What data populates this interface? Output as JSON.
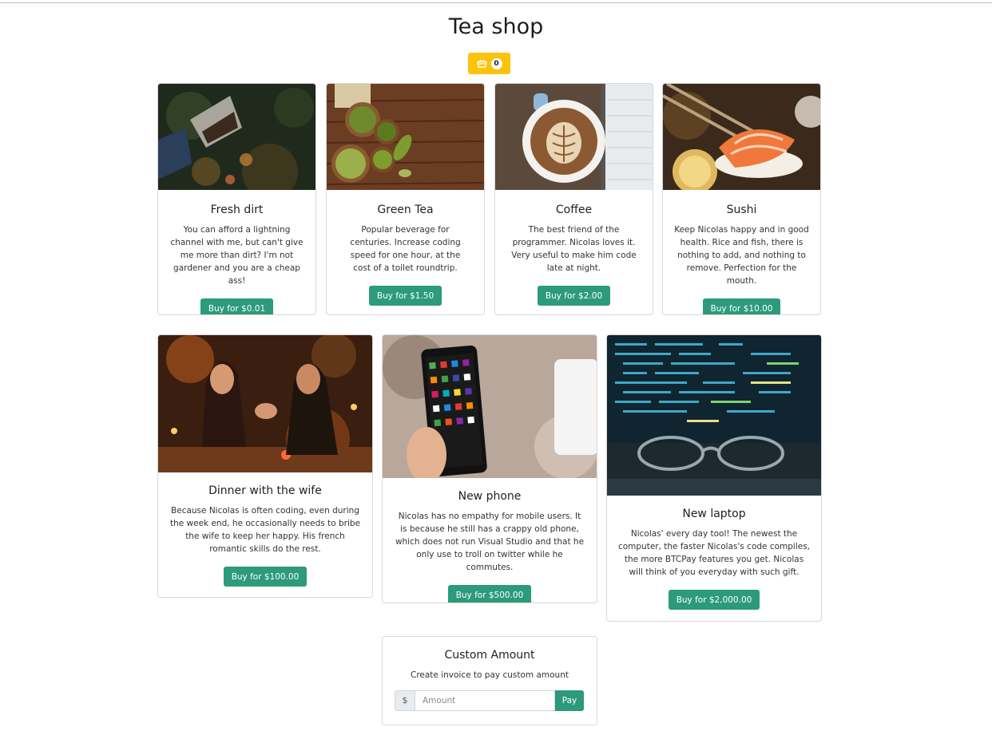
{
  "shop": {
    "title": "Tea shop",
    "cart_count": "0",
    "cart_icon": "basket-icon",
    "accent_color": "#fbc30b",
    "buy_color": "#2c9a7b"
  },
  "items": [
    {
      "title": "Fresh dirt",
      "description": "You can afford a lightning channel with me, but can't give me more than dirt? I'm not gardener and you are a cheap ass!",
      "button": "Buy for $0.01"
    },
    {
      "title": "Green Tea",
      "description": "Popular beverage for centuries. Increase coding speed for one hour, at the cost of a toilet roundtrip.",
      "button": "Buy for $1.50"
    },
    {
      "title": "Coffee",
      "description": "The best friend of the programmer. Nicolas loves it. Very useful to make him code late at night.",
      "button": "Buy for $2.00"
    },
    {
      "title": "Sushi",
      "description": "Keep Nicolas happy and in good health. Rice and fish, there is nothing to add, and nothing to remove. Perfection for the mouth.",
      "button": "Buy for $10.00"
    },
    {
      "title": "Dinner with the wife",
      "description": "Because Nicolas is often coding, even during the week end, he occasionally needs to bribe the wife to keep her happy. His french romantic skills do the rest.",
      "button": "Buy for $100.00"
    },
    {
      "title": "New phone",
      "description": "Nicolas has no empathy for mobile users. It is because he still has a crappy old phone, which does not run Visual Studio and that he only use to troll on twitter while he commutes.",
      "button": "Buy for $500.00"
    },
    {
      "title": "New laptop",
      "description": "Nicolas' every day tool! The newest the computer, the faster Nicolas's code compiles, the more BTCPay features you get. Nicolas will think of you everyday with such gift.",
      "button": "Buy for $2,000.00"
    }
  ],
  "custom": {
    "title": "Custom Amount",
    "description": "Create invoice to pay custom amount",
    "currency_symbol": "$",
    "amount_placeholder": "Amount",
    "pay_label": "Pay"
  }
}
